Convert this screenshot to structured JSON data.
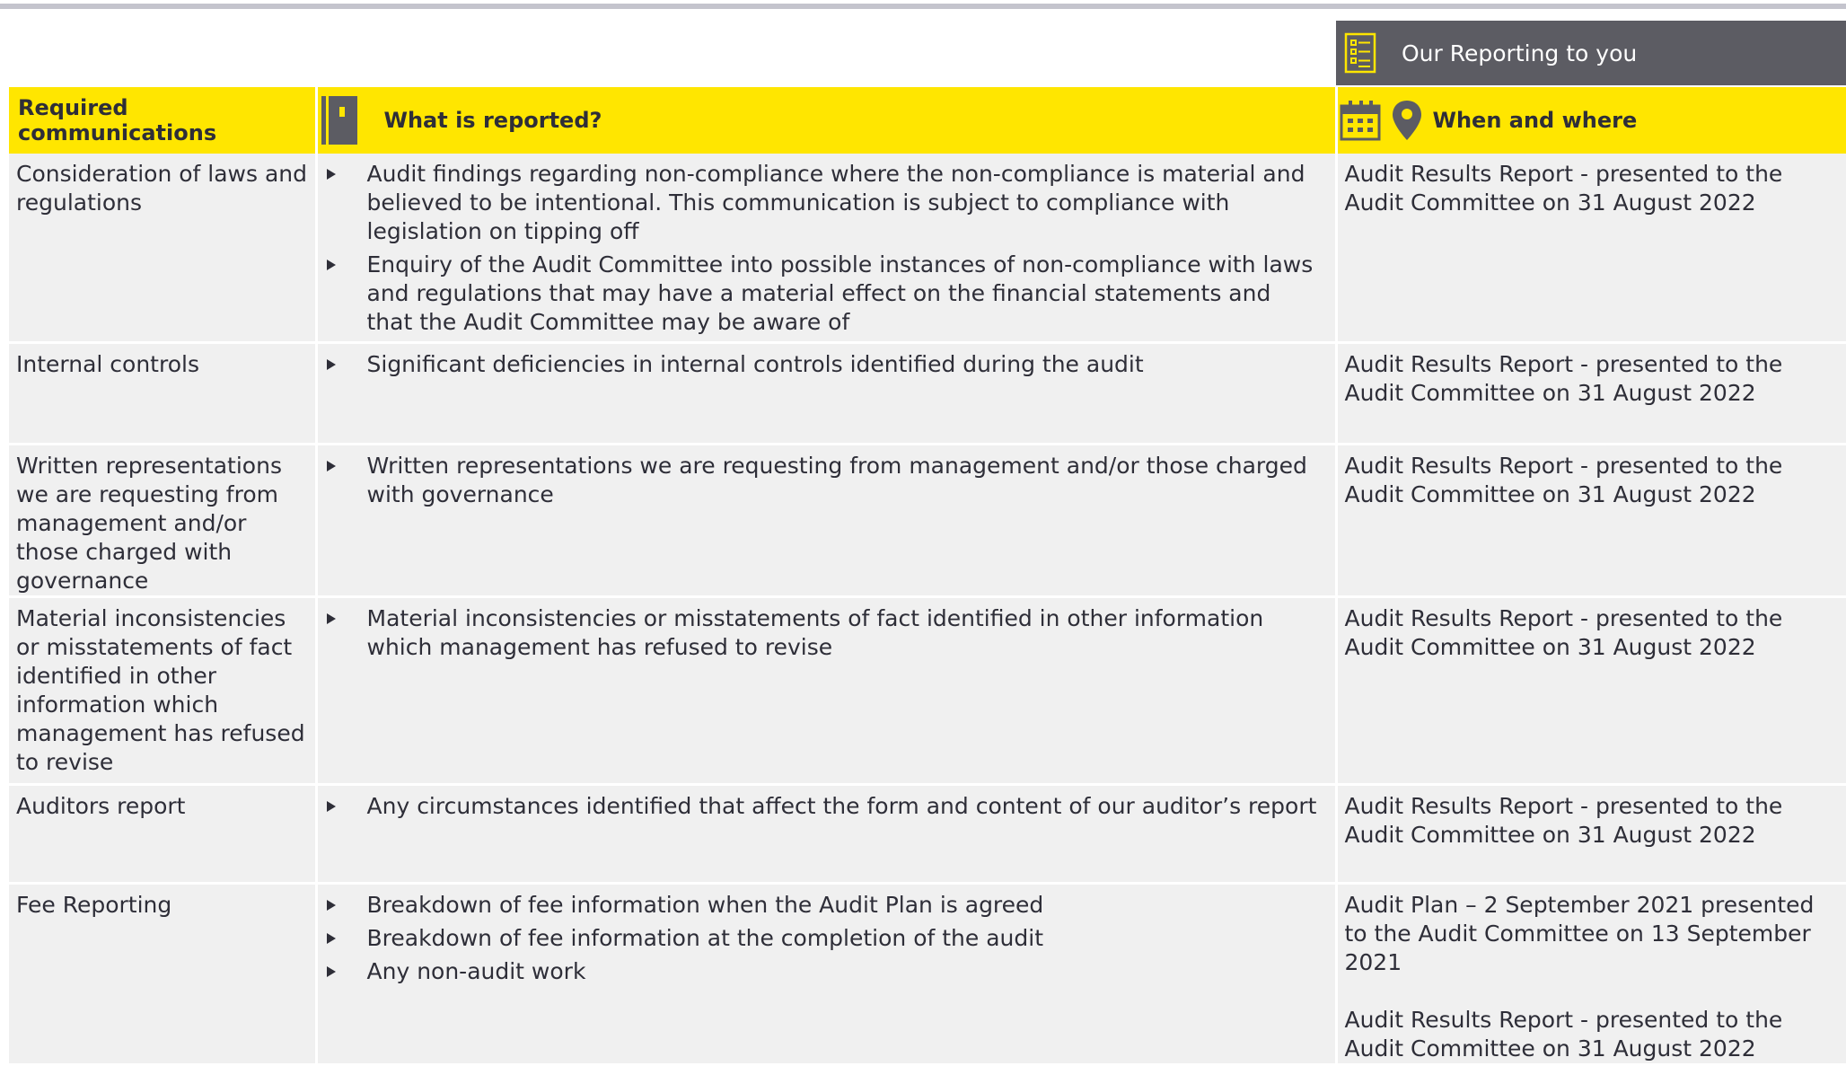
{
  "banner": {
    "title": "Our Reporting to you",
    "icon": "checklist-icon"
  },
  "header": {
    "col1": "Required communications",
    "col2": "What is reported?",
    "col3": "When and where",
    "col2_icon": "notebook-icon",
    "col3_icons": [
      "calendar-icon",
      "location-pin-icon"
    ]
  },
  "rows": [
    {
      "communication": "Consideration of laws and regulations",
      "items": [
        "Audit findings regarding non-compliance where the non-compliance is material and believed to be intentional. This communication is subject to compliance with legislation on tipping off",
        "Enquiry of the Audit Committee into possible instances of non-compliance with laws and regulations that may have a material effect on the financial statements and that the Audit Committee  may be aware of"
      ],
      "when": [
        "Audit Results Report - presented to the Audit Committee on 31 August 2022"
      ]
    },
    {
      "communication": "Internal controls",
      "items": [
        "Significant deficiencies in internal controls identified during the audit"
      ],
      "when": [
        "Audit Results Report - presented to the Audit Committee on 31 August 2022"
      ]
    },
    {
      "communication": "Written representations we are requesting from management and/or those charged with governance",
      "items": [
        "Written representations we are requesting from management and/or those charged with governance"
      ],
      "when": [
        "Audit Results Report - presented to the Audit Committee on 31 August 2022"
      ]
    },
    {
      "communication": "Material inconsistencies or misstatements of fact identified in other information which management has refused to revise",
      "items": [
        "Material inconsistencies or misstatements of fact identified in other information which management has refused to revise"
      ],
      "when": [
        "Audit Results Report - presented to the Audit Committee on 31 August 2022"
      ]
    },
    {
      "communication": "Auditors report",
      "items": [
        "Any circumstances identified that affect the form and content of our auditor’s report"
      ],
      "when": [
        "Audit Results Report - presented to the Audit Committee on 31 August 2022"
      ]
    },
    {
      "communication": "Fee Reporting",
      "items": [
        "Breakdown of fee information when the  Audit Plan is agreed",
        "Breakdown of fee information at the completion of the audit",
        "Any non-audit work"
      ],
      "when": [
        "Audit Plan – 2 September 2021 presented to the Audit Committee on 13 September 2021",
        "Audit Results Report - presented to the Audit Committee on 31 August 2022"
      ]
    }
  ],
  "colors": {
    "accent_yellow": "#ffe600",
    "banner_grey": "#5c5c63",
    "cell_grey": "#f0f0f0",
    "text": "#2e2e38"
  }
}
